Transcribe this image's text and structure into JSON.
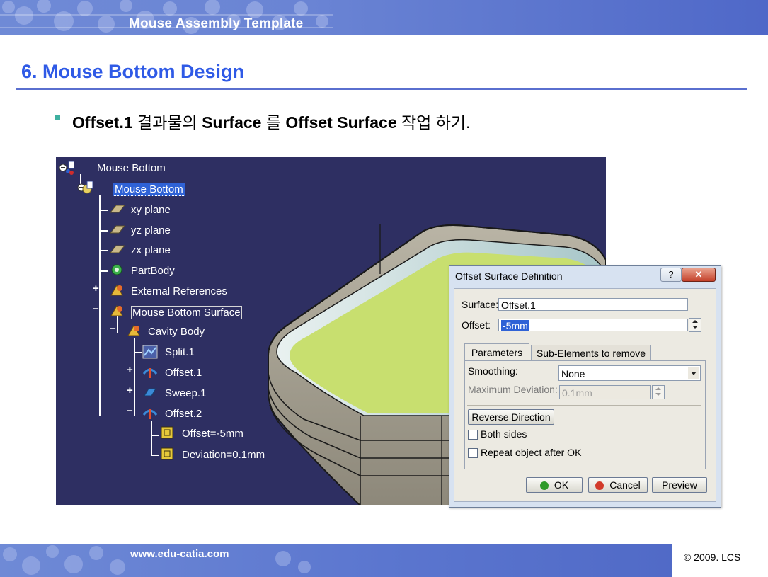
{
  "header": {
    "title": "Mouse Assembly Template"
  },
  "slide": {
    "heading": "6. Mouse Bottom Design",
    "bullet": {
      "part1": "Offset.1",
      "part2": " 결과물의 ",
      "part3": "Surface",
      "part4": " 를 ",
      "part5": "Offset Surface",
      "part6": " 작업 하기."
    }
  },
  "tree": {
    "root": "Mouse Bottom",
    "part": "Mouse Bottom",
    "xy": "xy plane",
    "yz": "yz plane",
    "zx": "zx plane",
    "partbody": "PartBody",
    "extref": "External References",
    "surface": "Mouse Bottom Surface",
    "cavity": "Cavity Body",
    "split": "Split.1",
    "offset1": "Offset.1",
    "sweep": "Sweep.1",
    "offset2": "Offset.2",
    "param1": "Offset=-5mm",
    "param2": "Deviation=0.1mm"
  },
  "dialog": {
    "title": "Offset Surface Definition",
    "help_label": "?",
    "close_label": "✕",
    "surface_label": "Surface:",
    "surface_value": "Offset.1",
    "offset_label": "Offset:",
    "offset_value": "-5mm",
    "tab_parameters": "Parameters",
    "tab_subelements": "Sub-Elements to remove",
    "smoothing_label": "Smoothing:",
    "smoothing_value": "None",
    "maxdev_label": "Maximum Deviation:",
    "maxdev_value": "0.1mm",
    "reverse_label": "Reverse Direction",
    "both_sides_label": "Both sides",
    "repeat_label": "Repeat object after OK",
    "ok_label": "OK",
    "cancel_label": "Cancel",
    "preview_label": "Preview",
    "ok_color": "#2f9a2a",
    "cancel_color": "#d23a2a"
  },
  "footer": {
    "url": "www.edu-catia.com",
    "copyright": "© 2009. LCS"
  }
}
